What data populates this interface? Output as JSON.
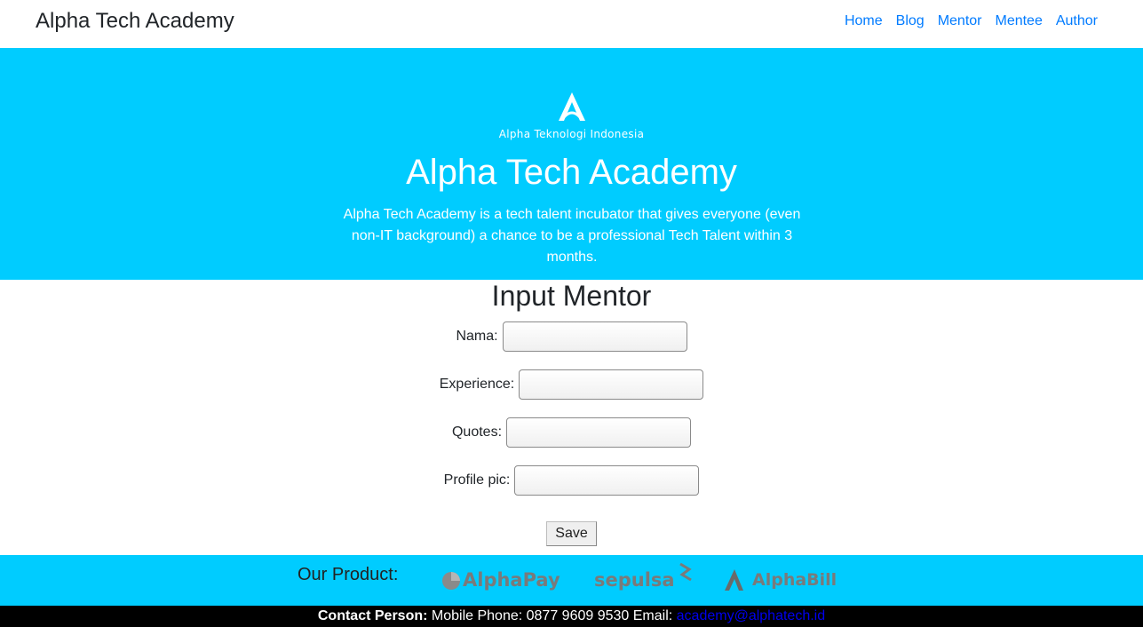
{
  "navbar": {
    "brand": "Alpha Tech Academy",
    "links": [
      "Home",
      "Blog",
      "Mentor",
      "Mentee",
      "Author"
    ]
  },
  "hero": {
    "logo_text": "Alpha Teknologi Indonesia",
    "title": "Alpha Tech Academy",
    "description": "Alpha Tech Academy is a tech talent incubator that gives everyone (even non-IT background) a chance to be a professional Tech Talent within 3 months."
  },
  "form": {
    "title": "Input Mentor",
    "fields": [
      {
        "label": "Nama:",
        "value": ""
      },
      {
        "label": "Experience:",
        "value": ""
      },
      {
        "label": "Quotes:",
        "value": ""
      },
      {
        "label": "Profile pic:",
        "value": ""
      }
    ],
    "save_label": "Save"
  },
  "products": {
    "label": "Our Product:",
    "items": [
      "AlphaPay",
      "sepulsa",
      "AlphaBill"
    ]
  },
  "footer": {
    "contact_label": "Contact Person:",
    "details": " Mobile Phone: 0877 9609 9530 Email: ",
    "email": "academy@alphatech.id"
  },
  "colors": {
    "hero_bg": "#00ccff",
    "nav_link": "#007bff",
    "footer_bg": "#000000"
  }
}
